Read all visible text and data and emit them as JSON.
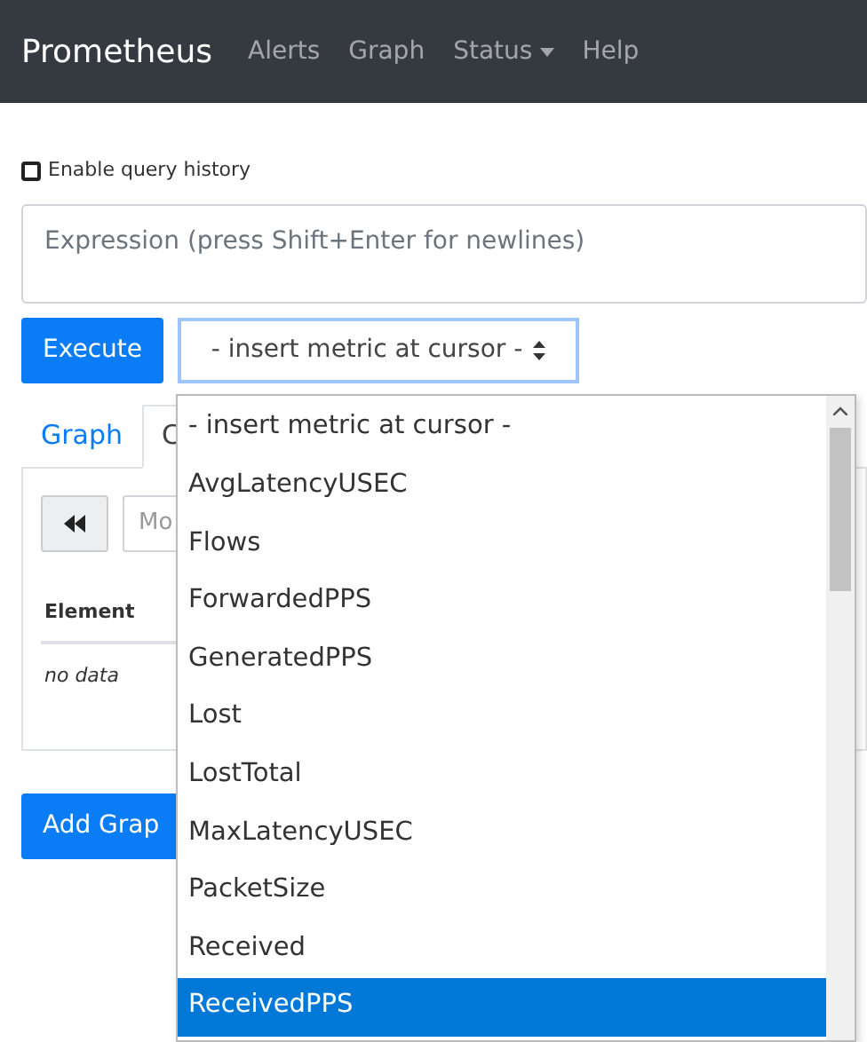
{
  "navbar": {
    "brand": "Prometheus",
    "links": [
      {
        "label": "Alerts",
        "kind": "link"
      },
      {
        "label": "Graph",
        "kind": "link"
      },
      {
        "label": "Status",
        "kind": "dropdown"
      },
      {
        "label": "Help",
        "kind": "link"
      }
    ]
  },
  "query_history": {
    "label": "Enable query history",
    "checked": false
  },
  "expression": {
    "placeholder": "Expression (press Shift+Enter for newlines)"
  },
  "execute_button": "Execute",
  "metric_select": {
    "value": "- insert metric at cursor -"
  },
  "tabs": [
    {
      "label": "Graph",
      "selected": false
    },
    {
      "label": "C",
      "selected": true
    }
  ],
  "moment": {
    "placeholder": "Mo"
  },
  "table": {
    "columns": [
      "Element"
    ],
    "empty_text": "no data"
  },
  "add_graph_button": "Add Grap",
  "metric_options": [
    {
      "label": "- insert metric at cursor -",
      "selected": false
    },
    {
      "label": "AvgLatencyUSEC",
      "selected": false
    },
    {
      "label": "Flows",
      "selected": false
    },
    {
      "label": "ForwardedPPS",
      "selected": false
    },
    {
      "label": "GeneratedPPS",
      "selected": false
    },
    {
      "label": "Lost",
      "selected": false
    },
    {
      "label": "LostTotal",
      "selected": false
    },
    {
      "label": "MaxLatencyUSEC",
      "selected": false
    },
    {
      "label": "PacketSize",
      "selected": false
    },
    {
      "label": "Received",
      "selected": false
    },
    {
      "label": "ReceivedPPS",
      "selected": true
    }
  ]
}
